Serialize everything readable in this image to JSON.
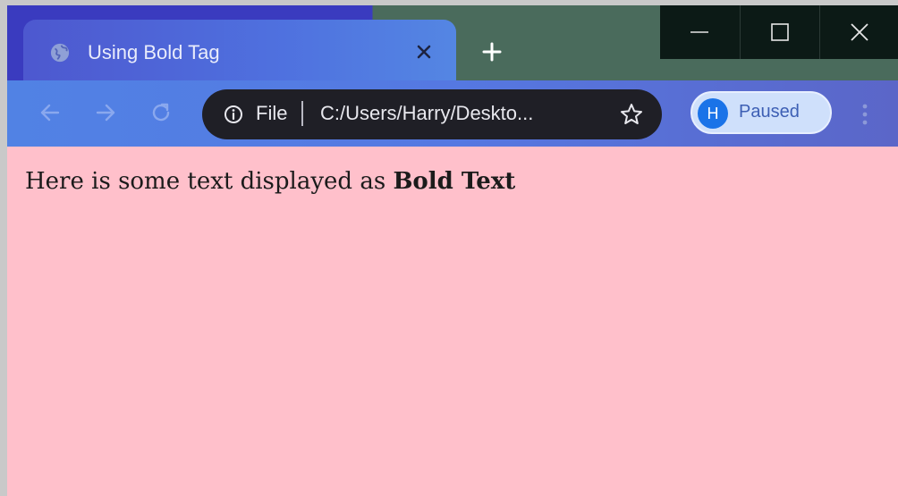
{
  "tab": {
    "title": "Using Bold Tag"
  },
  "address_bar": {
    "scheme_label": "File",
    "url": "C:/Users/Harry/Deskto..."
  },
  "profile": {
    "initial": "H",
    "status": "Paused"
  },
  "page": {
    "text": "Here is some text displayed as ",
    "bold_text": "Bold Text"
  },
  "icons": {
    "favicon": "globe-icon",
    "tab_close": "close-icon",
    "new_tab": "plus-icon",
    "back": "arrow-left-icon",
    "forward": "arrow-right-icon",
    "reload": "reload-icon",
    "site_info": "info-icon",
    "bookmark": "star-icon",
    "menu": "kebab-menu-icon",
    "minimize": "minimize-icon",
    "maximize": "maximize-icon",
    "close": "close-icon"
  },
  "colors": {
    "page_background": "#ffc0cb",
    "toolbar": "#5578e2",
    "omnibox": "#1f1f26",
    "avatar": "#1a73e8"
  }
}
